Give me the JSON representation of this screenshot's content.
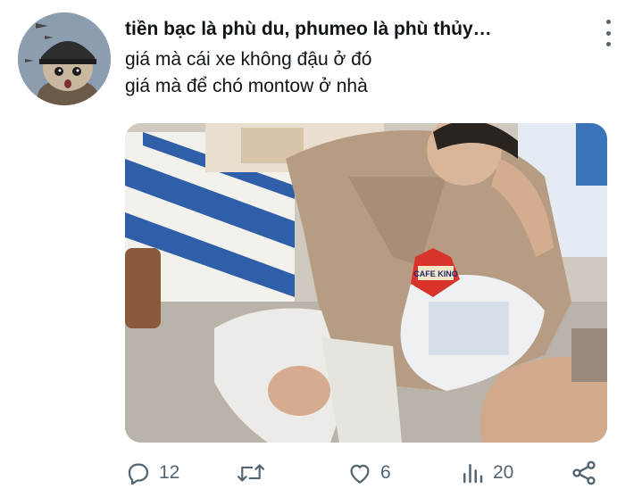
{
  "tweet": {
    "author_name": "tiền bạc là phù du, phumeo là phù thủy…",
    "lines": [
      "giá mà cái xe không đậu ở đó",
      "giá mà để chó montow ở nhà"
    ]
  },
  "media": {
    "badge_text": "CAFE KINO"
  },
  "actions": {
    "reply_count": "12",
    "retweet_count": "",
    "like_count": "6",
    "views_count": "20"
  },
  "icons": {
    "reply": "reply-icon",
    "retweet": "retweet-icon",
    "like": "heart-icon",
    "views": "views-icon",
    "share": "share-icon",
    "more": "more-icon"
  },
  "colors": {
    "text": "#0f1419",
    "muted": "#536471"
  }
}
